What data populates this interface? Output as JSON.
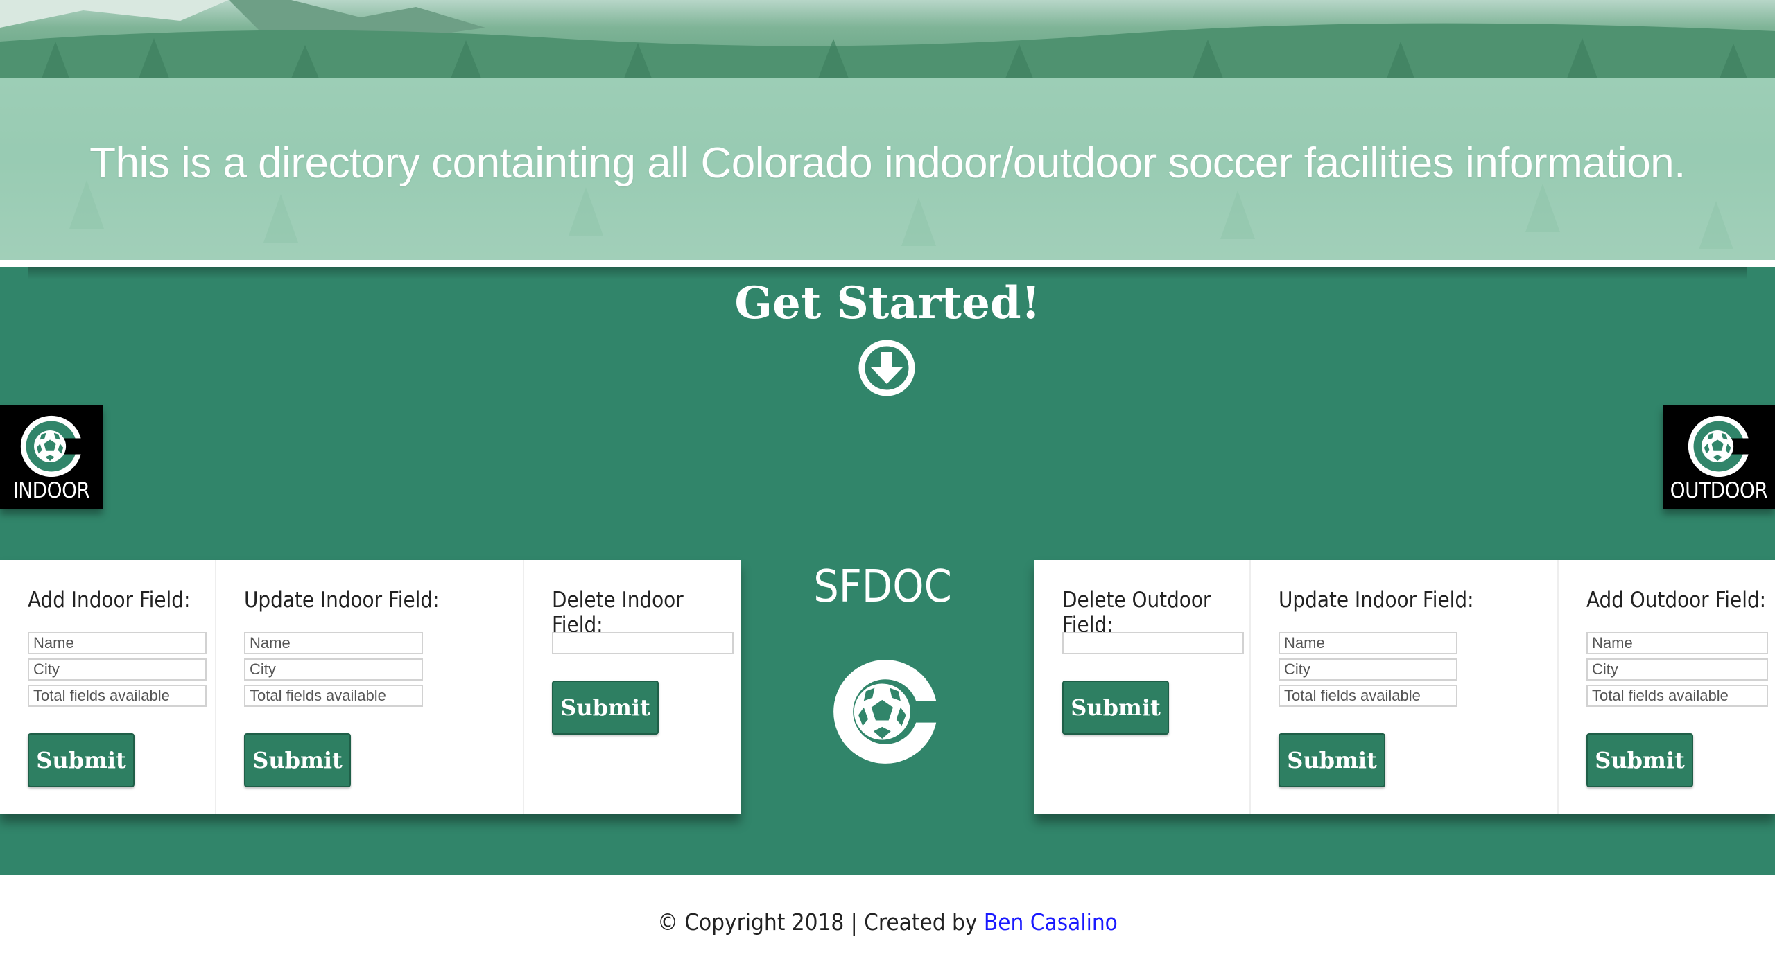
{
  "hero": {
    "tagline": "This is a directory containting all Colorado indoor/outdoor soccer facilities information."
  },
  "main": {
    "get_started": "Get Started!",
    "down_icon": "arrow-circle-down-icon",
    "indoor_label": "INDOOR",
    "outdoor_label": "OUTDOOR",
    "center_title": "SFDOC"
  },
  "forms": {
    "add_indoor": {
      "title": "Add Indoor Field:",
      "name_placeholder": "Name",
      "city_placeholder": "City",
      "total_placeholder": "Total fields available",
      "submit": "Submit"
    },
    "update_indoor": {
      "title": "Update Indoor Field:",
      "name_placeholder": "Name",
      "city_placeholder": "City",
      "total_placeholder": "Total fields available",
      "submit": "Submit"
    },
    "delete_indoor": {
      "title": "Delete Indoor Field:",
      "input_placeholder": "",
      "submit": "Submit"
    },
    "delete_outdoor": {
      "title": "Delete Outdoor Field:",
      "input_placeholder": "",
      "submit": "Submit"
    },
    "update_outdoor": {
      "title": "Update Indoor Field:",
      "name_placeholder": "Name",
      "city_placeholder": "City",
      "total_placeholder": "Total fields available",
      "submit": "Submit"
    },
    "add_outdoor": {
      "title": "Add Outdoor Field:",
      "name_placeholder": "Name",
      "city_placeholder": "City",
      "total_placeholder": "Total fields available",
      "submit": "Submit"
    }
  },
  "footer": {
    "copyright": "© Copyright 2018 | Created by ",
    "author": "Ben Casalino"
  },
  "colors": {
    "primary_green": "#31856a",
    "button_green": "#2e7f62",
    "link_blue": "#1a1aff"
  }
}
